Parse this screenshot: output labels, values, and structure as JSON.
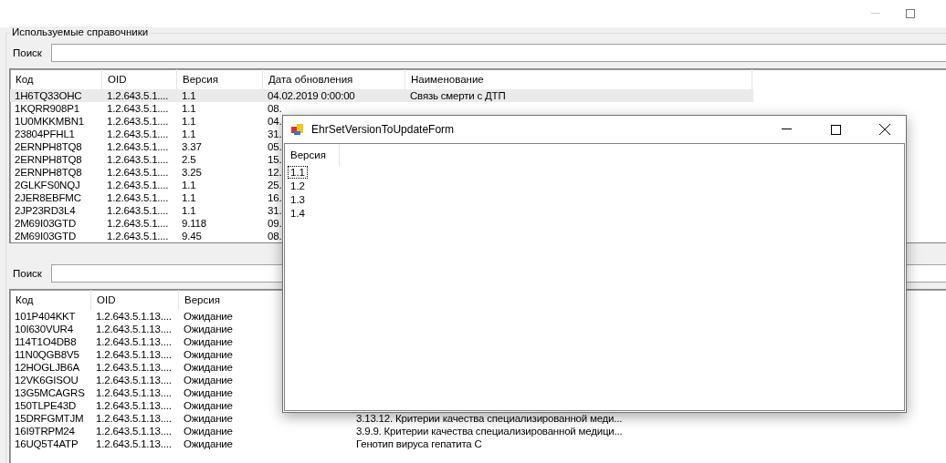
{
  "main_window": {
    "group_title": "Используемые справочники",
    "top_search": {
      "label": "Поиск"
    },
    "top_table": {
      "columns": [
        "Код",
        "OID",
        "Версия",
        "Дата обновления",
        "Наименование"
      ],
      "rows": [
        {
          "code": "1H6TQ33OHC",
          "oid": "1.2.643.5.1....",
          "version": "1.1",
          "date": "04.02.2019 0:00:00",
          "name": "Связь смерти с ДТП",
          "selected": true
        },
        {
          "code": "1KQRR908P1",
          "oid": "1.2.643.5.1....",
          "version": "1.1",
          "date": "08.",
          "selected": false
        },
        {
          "code": "1U0MKKMBN1",
          "oid": "1.2.643.5.1....",
          "version": "1.1",
          "date": "04.",
          "selected": false
        },
        {
          "code": "23804PFHL1",
          "oid": "1.2.643.5.1....",
          "version": "1.1",
          "date": "31.",
          "selected": false
        },
        {
          "code": "2ERNPH8TQ8",
          "oid": "1.2.643.5.1....",
          "version": "3.37",
          "date": "05.",
          "selected": false
        },
        {
          "code": "2ERNPH8TQ8",
          "oid": "1.2.643.5.1....",
          "version": "2.5",
          "date": "15.",
          "selected": false
        },
        {
          "code": "2ERNPH8TQ8",
          "oid": "1.2.643.5.1....",
          "version": "3.25",
          "date": "12.",
          "selected": false
        },
        {
          "code": "2GLKFS0NQJ",
          "oid": "1.2.643.5.1....",
          "version": "1.1",
          "date": "25.",
          "selected": false
        },
        {
          "code": "2JER8EBFMC",
          "oid": "1.2.643.5.1....",
          "version": "1.1",
          "date": "16.",
          "selected": false
        },
        {
          "code": "2JP23RD3L4",
          "oid": "1.2.643.5.1....",
          "version": "1.1",
          "date": "31.",
          "selected": false
        },
        {
          "code": "2M69I03GTD",
          "oid": "1.2.643.5.1....",
          "version": "9.118",
          "date": "09.",
          "selected": false
        },
        {
          "code": "2M69I03GTD",
          "oid": "1.2.643.5.1....",
          "version": "9.45",
          "date": "08.",
          "selected": false
        }
      ]
    },
    "bottom_search": {
      "label": "Поиск"
    },
    "bottom_table": {
      "columns": [
        "Код",
        "OID",
        "Версия"
      ],
      "rows": [
        {
          "code": "101P404KKT",
          "oid": "1.2.643.5.1.13....",
          "version": "Ожидание"
        },
        {
          "code": "10I630VUR4",
          "oid": "1.2.643.5.1.13....",
          "version": "Ожидание"
        },
        {
          "code": "114T1O4DB8",
          "oid": "1.2.643.5.1.13....",
          "version": "Ожидание"
        },
        {
          "code": "11N0QGB8V5",
          "oid": "1.2.643.5.1.13....",
          "version": "Ожидание"
        },
        {
          "code": "12HOGLJB6A",
          "oid": "1.2.643.5.1.13....",
          "version": "Ожидание"
        },
        {
          "code": "12VK6GISOU",
          "oid": "1.2.643.5.1.13....",
          "version": "Ожидание"
        },
        {
          "code": "13G5MCAGRS",
          "oid": "1.2.643.5.1.13....",
          "version": "Ожидание"
        },
        {
          "code": "150TLPE43D",
          "oid": "1.2.643.5.1.13....",
          "version": "Ожидание"
        },
        {
          "code": "15DRFGMTJM",
          "oid": "1.2.643.5.1.13....",
          "version": "Ожидание",
          "name": "3.13.12. Критерии качества специализированной меди..."
        },
        {
          "code": "16I9TRPM24",
          "oid": "1.2.643.5.1.13....",
          "version": "Ожидание",
          "name": "3.9.9. Критерии качества специализированной медици..."
        },
        {
          "code": "16UQ5T4ATP",
          "oid": "1.2.643.5.1.13....",
          "version": "Ожидание",
          "name": "Генотип вируса гепатита С"
        }
      ]
    }
  },
  "dialog": {
    "title": "EhrSetVersionToUpdateForm",
    "column": "Версия",
    "items": [
      {
        "label": "1.1",
        "focused": true
      },
      {
        "label": "1.2",
        "focused": false
      },
      {
        "label": "1.3",
        "focused": false
      },
      {
        "label": "1.4",
        "focused": false
      }
    ]
  }
}
